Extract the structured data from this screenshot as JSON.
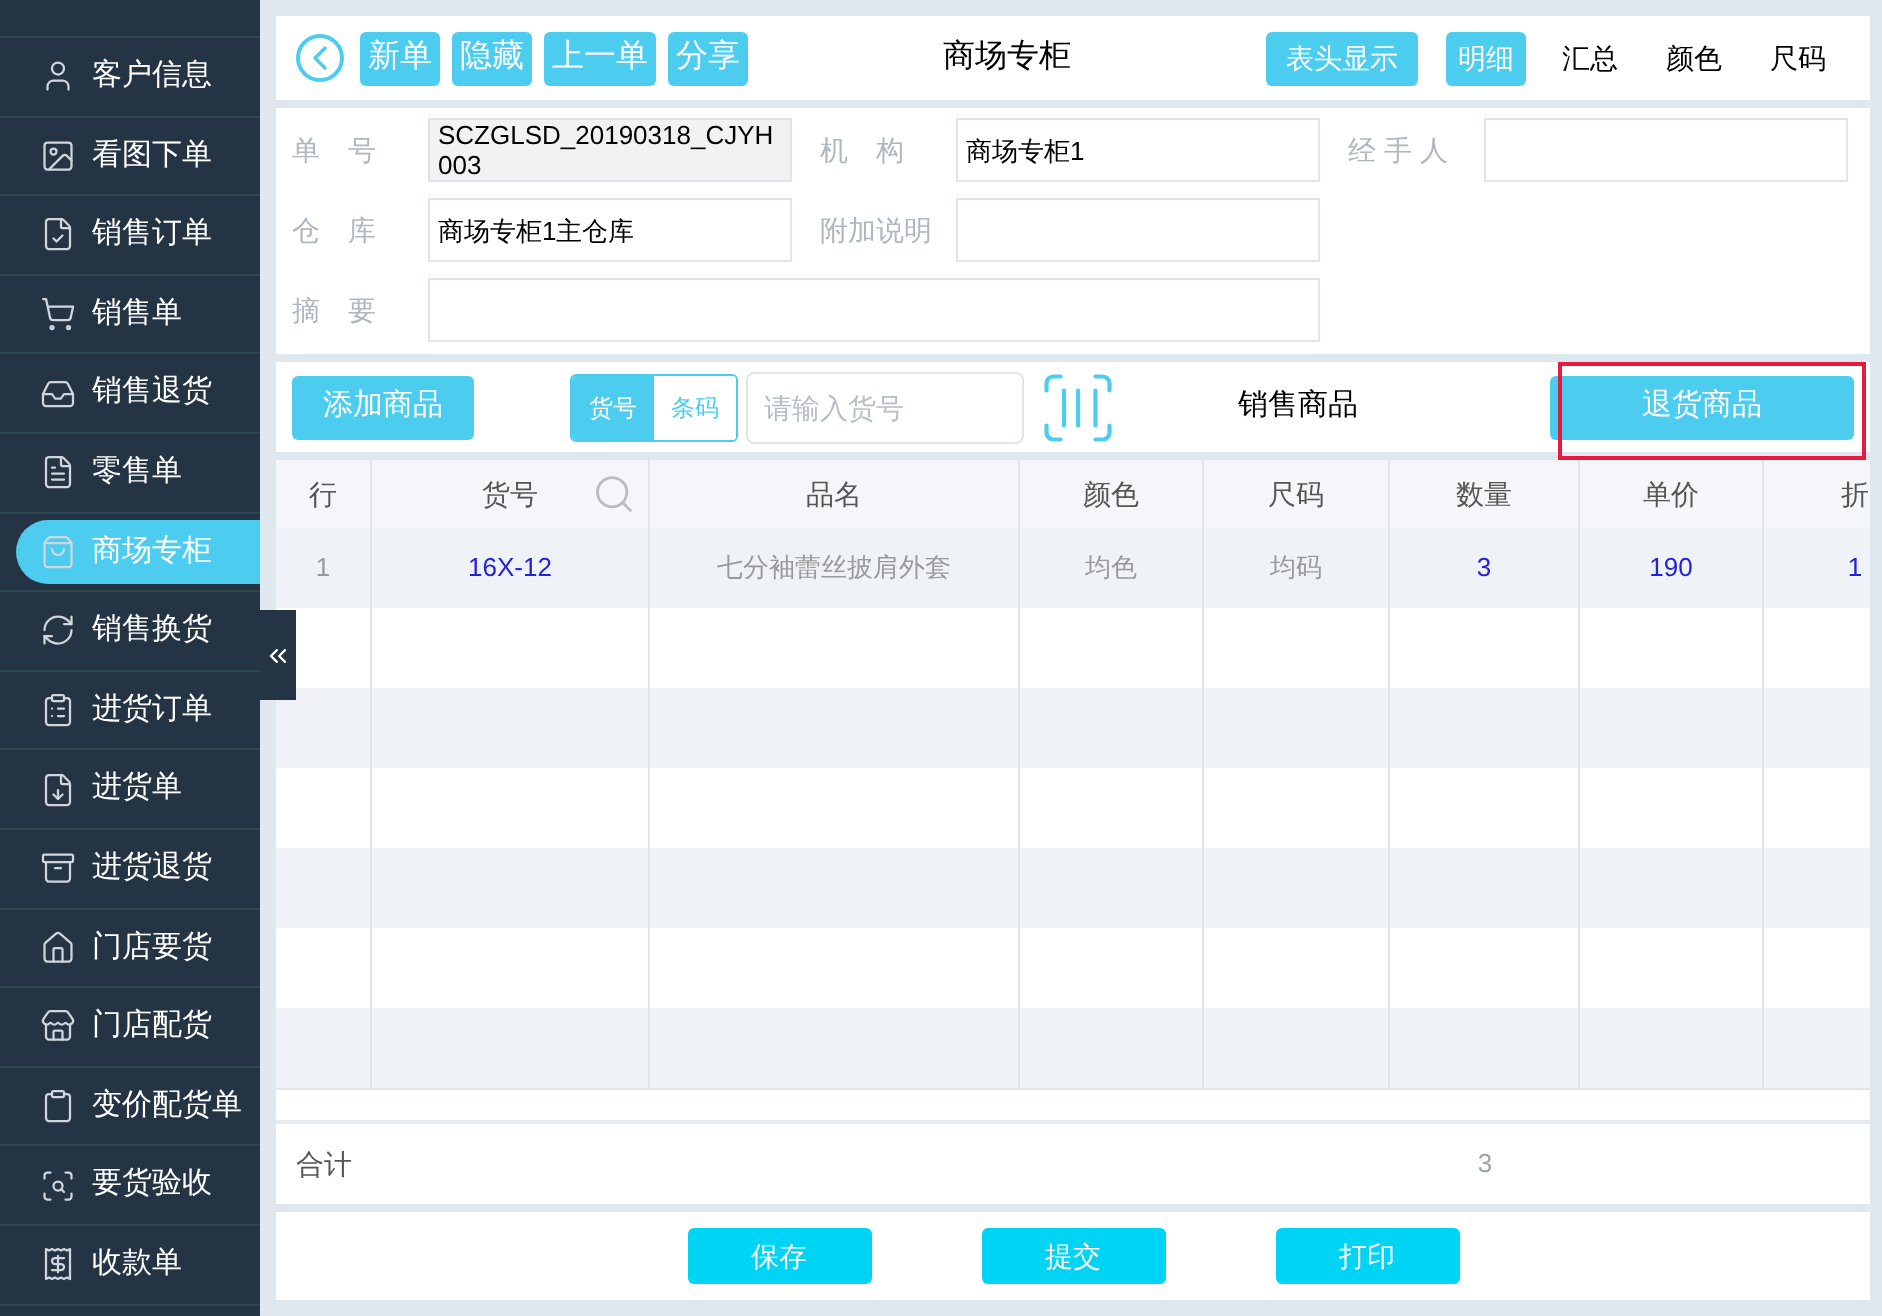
{
  "sidebar": {
    "items": [
      {
        "label": "客户信息",
        "selected": false
      },
      {
        "label": "看图下单",
        "selected": false
      },
      {
        "label": "销售订单",
        "selected": false
      },
      {
        "label": "销售单",
        "selected": false
      },
      {
        "label": "销售退货",
        "selected": false
      },
      {
        "label": "零售单",
        "selected": false
      },
      {
        "label": "商场专柜",
        "selected": true
      },
      {
        "label": "销售换货",
        "selected": false
      },
      {
        "label": "进货订单",
        "selected": false
      },
      {
        "label": "进货单",
        "selected": false
      },
      {
        "label": "进货退货",
        "selected": false
      },
      {
        "label": "门店要货",
        "selected": false
      },
      {
        "label": "门店配货",
        "selected": false
      },
      {
        "label": "变价配货单",
        "selected": false
      },
      {
        "label": "要货验收",
        "selected": false
      },
      {
        "label": "收款单",
        "selected": false
      }
    ]
  },
  "toolbar": {
    "buttons": [
      "新单",
      "隐藏",
      "上一单",
      "分享"
    ],
    "title": "商场专柜",
    "header_button": "表头显示",
    "views": [
      {
        "label": "明细",
        "selected": true
      },
      {
        "label": "汇总",
        "selected": false
      },
      {
        "label": "颜色",
        "selected": false
      },
      {
        "label": "尺码",
        "selected": false
      }
    ]
  },
  "form": {
    "fields": [
      {
        "label": "单　号",
        "value": "SCZGLSD_20190318_CJYH003",
        "disabled": true
      },
      {
        "label": "机　构",
        "value": "商场专柜1",
        "disabled": false
      },
      {
        "label": "经 手 人",
        "disabled": false
      },
      {
        "label": "仓　库",
        "value": "商场专柜1主仓库",
        "disabled": false
      },
      {
        "label": "附加说明",
        "disabled": false
      }
    ],
    "summary": {
      "label": "摘　要"
    }
  },
  "goods_bar": {
    "add_button": "添加商品",
    "code_modes": [
      {
        "label": "货号",
        "selected": true
      },
      {
        "label": "条码",
        "selected": false
      }
    ],
    "search": {
      "placeholder": "请输入货号"
    },
    "modes": [
      {
        "label": "销售商品",
        "selected": false
      },
      {
        "label": "退货商品",
        "selected": true
      }
    ]
  },
  "table": {
    "columns": [
      "行",
      "货号",
      "品名",
      "颜色",
      "尺码",
      "数量",
      "单价",
      "折"
    ],
    "rows": [
      [
        "1",
        "16X-12",
        "七分袖蕾丝披肩外套",
        "均色",
        "均码",
        "3",
        "190",
        "1"
      ]
    ],
    "total": {
      "label": "合计",
      "quantity": "3"
    }
  },
  "actions": [
    "保存",
    "提交",
    "打印"
  ]
}
